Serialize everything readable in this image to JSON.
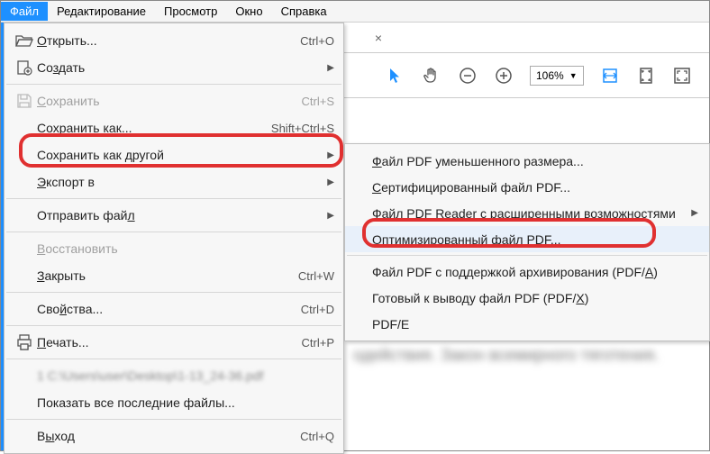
{
  "menubar": {
    "file": "Файл",
    "edit": "Редактирование",
    "view": "Просмотр",
    "window": "Окно",
    "help": "Справка"
  },
  "fileMenu": {
    "open": {
      "label": "Открыть...",
      "shortcut": "Ctrl+O"
    },
    "create": {
      "label": "Создать"
    },
    "save": {
      "label": "Сохранить",
      "shortcut": "Ctrl+S"
    },
    "saveAs": {
      "label": "Сохранить как...",
      "shortcut": "Shift+Ctrl+S"
    },
    "saveAsOther": {
      "label": "Сохранить как другой"
    },
    "exportTo": {
      "label": "Экспорт в"
    },
    "sendFile": {
      "label": "Отправить файл"
    },
    "revert": {
      "label": "Восстановить"
    },
    "close": {
      "label": "Закрыть",
      "shortcut": "Ctrl+W"
    },
    "properties": {
      "label": "Свойства...",
      "shortcut": "Ctrl+D"
    },
    "print": {
      "label": "Печать...",
      "shortcut": "Ctrl+P"
    },
    "recent1": {
      "label": "1 C:\\Users\\user\\Desktop\\1-13_24-36.pdf"
    },
    "showAllRecent": {
      "label": "Показать все последние файлы..."
    },
    "exit": {
      "label": "Выход",
      "shortcut": "Ctrl+Q"
    }
  },
  "submenu": {
    "reducedSize": "айл PDF уменьшенного размера...",
    "certified": "ертифицированный файл PDF...",
    "readerExtended": "Файл PDF Reader с р",
    "readerExtended2": "сширенными возможностями",
    "optimized": "птимизированный файл PDF...",
    "archival1": "Файл PDF с поддержкой архивирования (PDF/",
    "archival2": ")",
    "pressReady1": "Готовый к выводу файл PDF (PDF/",
    "pressReady2": ")",
    "pdfE": "PDF/E"
  },
  "toolbar": {
    "zoom": "106%"
  },
  "bgText": "одействия. Закон всемирного тяготения."
}
